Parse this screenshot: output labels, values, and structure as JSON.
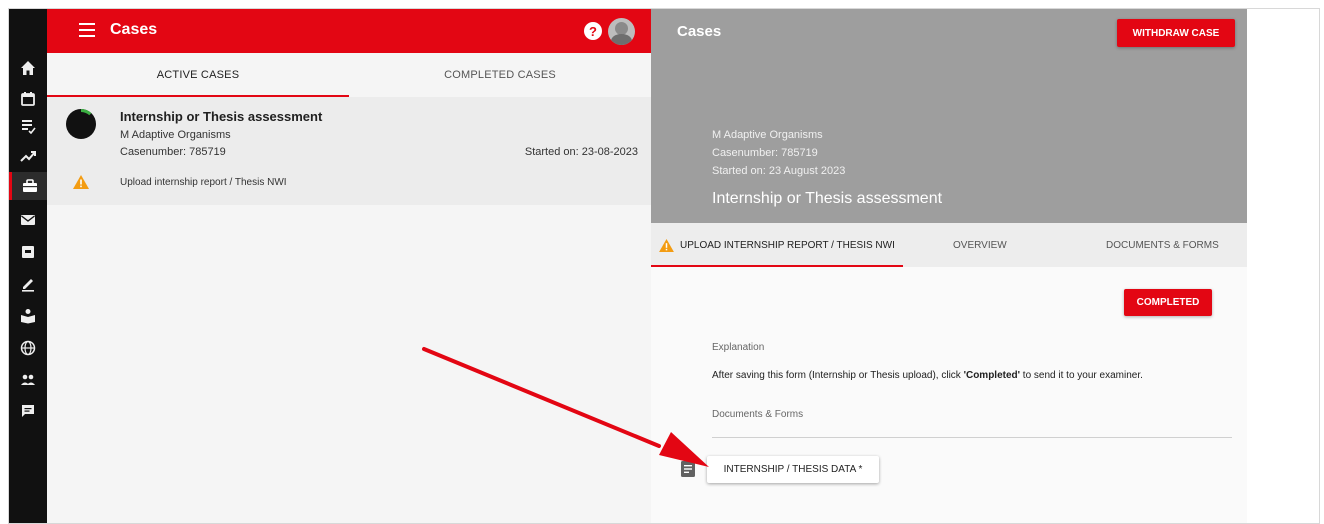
{
  "app": {
    "title": "Cases",
    "help_label": "?"
  },
  "rail": {
    "items": [
      {
        "icon": "home-icon"
      },
      {
        "icon": "calendar-icon"
      },
      {
        "icon": "checklist-icon"
      },
      {
        "icon": "trending-icon"
      },
      {
        "icon": "briefcase-icon",
        "active": true
      },
      {
        "icon": "mail-icon"
      },
      {
        "icon": "inbox-box-icon"
      },
      {
        "icon": "pen-icon"
      },
      {
        "icon": "reading-person-icon"
      },
      {
        "icon": "globe-icon"
      },
      {
        "icon": "people-icon"
      },
      {
        "icon": "feedback-icon"
      }
    ]
  },
  "left_tabs": {
    "active": "ACTIVE CASES",
    "completed": "COMPLETED CASES"
  },
  "case_card": {
    "title": "Internship or Thesis assessment",
    "subtitle": "M Adaptive Organisms",
    "case_number": "Casenumber: 785719",
    "started": "Started on: 23-08-2023",
    "task": "Upload internship report / Thesis NWI",
    "progress": 0.12
  },
  "detail": {
    "title": "Cases",
    "withdraw_label": "WITHDRAW CASE",
    "program": "M Adaptive Organisms",
    "case_number": "Casenumber: 785719",
    "started": "Started on: 23 August 2023",
    "case_title": "Internship or Thesis assessment",
    "tabs": {
      "upload": "UPLOAD INTERNSHIP REPORT / THESIS NWI",
      "overview": "OVERVIEW",
      "docs": "DOCUMENTS & FORMS"
    },
    "completed_label": "COMPLETED",
    "explanation_label": "Explanation",
    "explanation_before": "After saving this form (Internship or Thesis upload), click ",
    "explanation_bold": "'Completed'",
    "explanation_after": " to send it to your examiner.",
    "docs_label": "Documents & Forms",
    "form_button": "INTERNSHIP / THESIS DATA *"
  },
  "colors": {
    "brand_red": "#e30613",
    "warning": "#f39c12",
    "hero_gray": "#9e9e9e"
  }
}
